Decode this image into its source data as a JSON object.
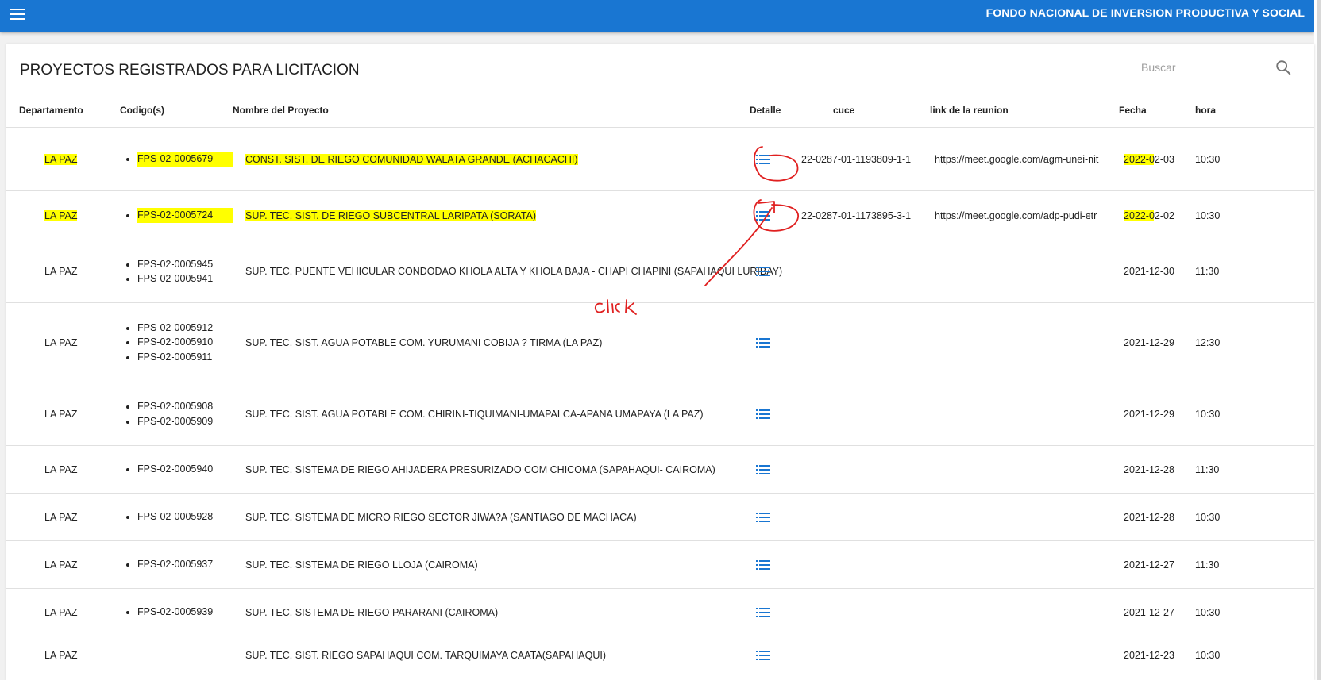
{
  "appbar": {
    "title": "FONDO NACIONAL DE INVERSION PRODUCTIVA Y SOCIAL",
    "color": "#1976d2"
  },
  "page": {
    "title": "PROYECTOS REGISTRADOS PARA LICITACION"
  },
  "search": {
    "placeholder": "Buscar"
  },
  "table": {
    "headers": [
      "Departamento",
      "Codigo(s)",
      "Nombre del Proyecto",
      "Detalle",
      "cuce",
      "link de la reunion",
      "Fecha",
      "hora"
    ],
    "rows": [
      {
        "departamento": "LA PAZ",
        "codigos": [
          "FPS-02-0005679"
        ],
        "nombre": "CONST. SIST. DE RIEGO COMUNIDAD WALATA GRANDE (ACHACACHI)",
        "cuce": "22-0287-01-1193809-1-1",
        "link": "https://meet.google.com/agm-unei-nit",
        "fecha": "2022-02-03",
        "hora": "10:30",
        "highlighted": true
      },
      {
        "departamento": "LA PAZ",
        "codigos": [
          "FPS-02-0005724"
        ],
        "nombre": "SUP. TEC. SIST. DE RIEGO SUBCENTRAL LARIPATA (SORATA)",
        "cuce": "22-0287-01-1173895-3-1",
        "link": "https://meet.google.com/adp-pudi-etr",
        "fecha": "2022-02-02",
        "hora": "10:30",
        "highlighted": true
      },
      {
        "departamento": "LA PAZ",
        "codigos": [
          "FPS-02-0005945",
          "FPS-02-0005941"
        ],
        "nombre": "SUP. TEC. PUENTE VEHICULAR CONDODAO KHOLA ALTA Y KHOLA BAJA - CHAPI CHAPINI (SAPAHAQUI LURIBAY)",
        "cuce": "",
        "link": "",
        "fecha": "2021-12-30",
        "hora": "11:30"
      },
      {
        "departamento": "LA PAZ",
        "codigos": [
          "FPS-02-0005912",
          "FPS-02-0005910",
          "FPS-02-0005911"
        ],
        "nombre": "SUP. TEC. SIST. AGUA POTABLE COM. YURUMANI COBIJA ? TIRMA (LA PAZ)",
        "cuce": "",
        "link": "",
        "fecha": "2021-12-29",
        "hora": "12:30"
      },
      {
        "departamento": "LA PAZ",
        "codigos": [
          "FPS-02-0005908",
          "FPS-02-0005909"
        ],
        "nombre": "SUP. TEC. SIST. AGUA POTABLE COM. CHIRINI-TIQUIMANI-UMAPALCA-APANA UMAPAYA (LA PAZ)",
        "cuce": "",
        "link": "",
        "fecha": "2021-12-29",
        "hora": "10:30"
      },
      {
        "departamento": "LA PAZ",
        "codigos": [
          "FPS-02-0005940"
        ],
        "nombre": "SUP. TEC. SISTEMA DE RIEGO AHIJADERA PRESURIZADO COM CHICOMA (SAPAHAQUI- CAIROMA)",
        "cuce": "",
        "link": "",
        "fecha": "2021-12-28",
        "hora": "11:30"
      },
      {
        "departamento": "LA PAZ",
        "codigos": [
          "FPS-02-0005928"
        ],
        "nombre": "SUP. TEC. SISTEMA DE MICRO RIEGO SECTOR JIWA?A (SANTIAGO DE MACHACA)",
        "cuce": "",
        "link": "",
        "fecha": "2021-12-28",
        "hora": "10:30"
      },
      {
        "departamento": "LA PAZ",
        "codigos": [
          "FPS-02-0005937"
        ],
        "nombre": "SUP. TEC. SISTEMA DE RIEGO LLOJA (CAIROMA)",
        "cuce": "",
        "link": "",
        "fecha": "2021-12-27",
        "hora": "11:30"
      },
      {
        "departamento": "LA PAZ",
        "codigos": [
          "FPS-02-0005939"
        ],
        "nombre": "SUP. TEC. SISTEMA DE RIEGO PARARANI (CAIROMA)",
        "cuce": "",
        "link": "",
        "fecha": "2021-12-27",
        "hora": "10:30"
      },
      {
        "departamento": "LA PAZ",
        "codigos": [],
        "nombre": "SUP. TEC. SIST. RIEGO SAPAHAQUI COM. TARQUIMAYA CAATA(SAPAHAQUI)",
        "cuce": "",
        "link": "",
        "fecha": "2021-12-23",
        "hora": "10:30"
      }
    ]
  },
  "annotation": {
    "handwritten_text": "click",
    "highlight_color": "#ffff00",
    "ink_color": "#e02020"
  },
  "icons": {
    "menu": "menu-icon",
    "search": "search-icon",
    "detail": "list-icon"
  }
}
